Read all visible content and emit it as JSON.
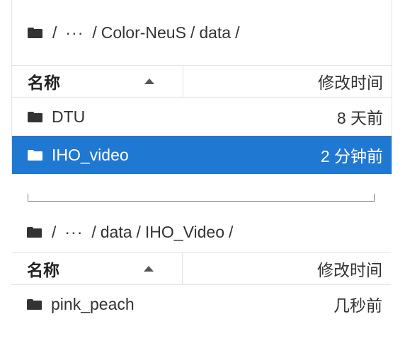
{
  "panel1": {
    "breadcrumb": {
      "root_sep": "/",
      "ellipsis": "···",
      "parts": [
        "Color-NeuS",
        "data"
      ]
    },
    "header": {
      "name_label": "名称",
      "modified_label": "修改时间"
    },
    "rows": [
      {
        "name": "DTU",
        "modified": "8 天前",
        "selected": false
      },
      {
        "name": "IHO_video",
        "modified": "2 分钟前",
        "selected": true
      }
    ]
  },
  "panel2": {
    "breadcrumb": {
      "root_sep": "/",
      "ellipsis": "···",
      "parts": [
        "data",
        "IHO_Video"
      ]
    },
    "header": {
      "name_label": "名称",
      "modified_label": "修改时间"
    },
    "rows": [
      {
        "name": "pink_peach",
        "modified": "几秒前",
        "selected": false
      }
    ]
  },
  "colors": {
    "selection": "#1f78d1",
    "border": "#e3e3e3"
  },
  "icons": [
    "folder-icon",
    "sort-ascending-icon",
    "ellipsis-icon"
  ]
}
